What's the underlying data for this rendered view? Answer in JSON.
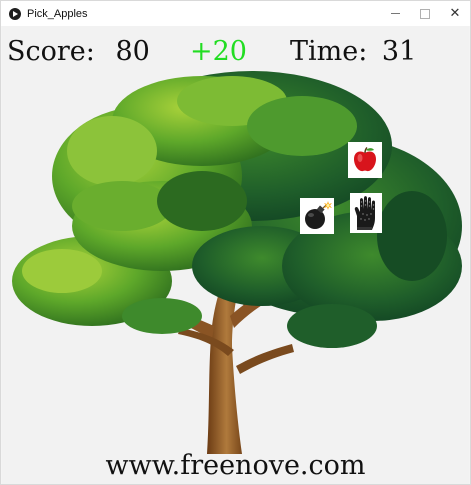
{
  "window": {
    "title": "Pick_Apples",
    "minimize_icon": "minimize-icon",
    "maximize_icon": "maximize-icon",
    "close_glyph": "✕"
  },
  "hud": {
    "score_label": "Score:",
    "score_value": "80",
    "bonus": "+20",
    "time_label": "Time:",
    "time_value": "31",
    "bonus_color": "#22dd22"
  },
  "footer": {
    "url": "www.freenove.com"
  },
  "items": {
    "apple": "apple-icon",
    "bomb": "bomb-icon",
    "glove": "glove-icon"
  }
}
